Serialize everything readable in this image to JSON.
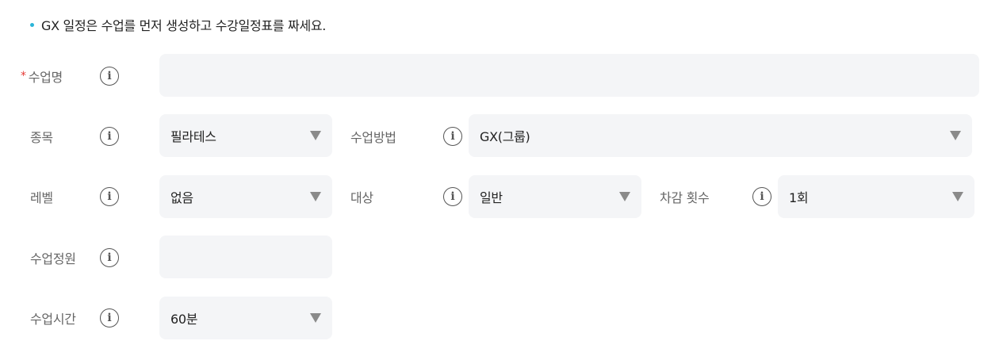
{
  "notice": {
    "text": "GX 일정은 수업를 먼저 생성하고 수강일정표를 짜세요."
  },
  "form": {
    "class_name": {
      "label": "수업명",
      "required_mark": "*",
      "value": "",
      "placeholder": ""
    },
    "category": {
      "label": "종목",
      "value": "필라테스"
    },
    "method": {
      "label": "수업방법",
      "value": "GX(그룹)"
    },
    "level": {
      "label": "레벨",
      "value": "없음"
    },
    "target": {
      "label": "대상",
      "value": "일반"
    },
    "deduction": {
      "label": "차감 횟수",
      "value": "1회"
    },
    "capacity": {
      "label": "수업정원",
      "value": "",
      "placeholder": ""
    },
    "duration": {
      "label": "수업시간",
      "value": "60분"
    }
  },
  "icons": {
    "info": "info-circle-icon",
    "caret": "caret-down-icon",
    "bullet": "bullet-dot-icon"
  },
  "colors": {
    "accent": "#2bb5d8",
    "required": "#e53935",
    "field_bg": "#f4f5f7"
  }
}
